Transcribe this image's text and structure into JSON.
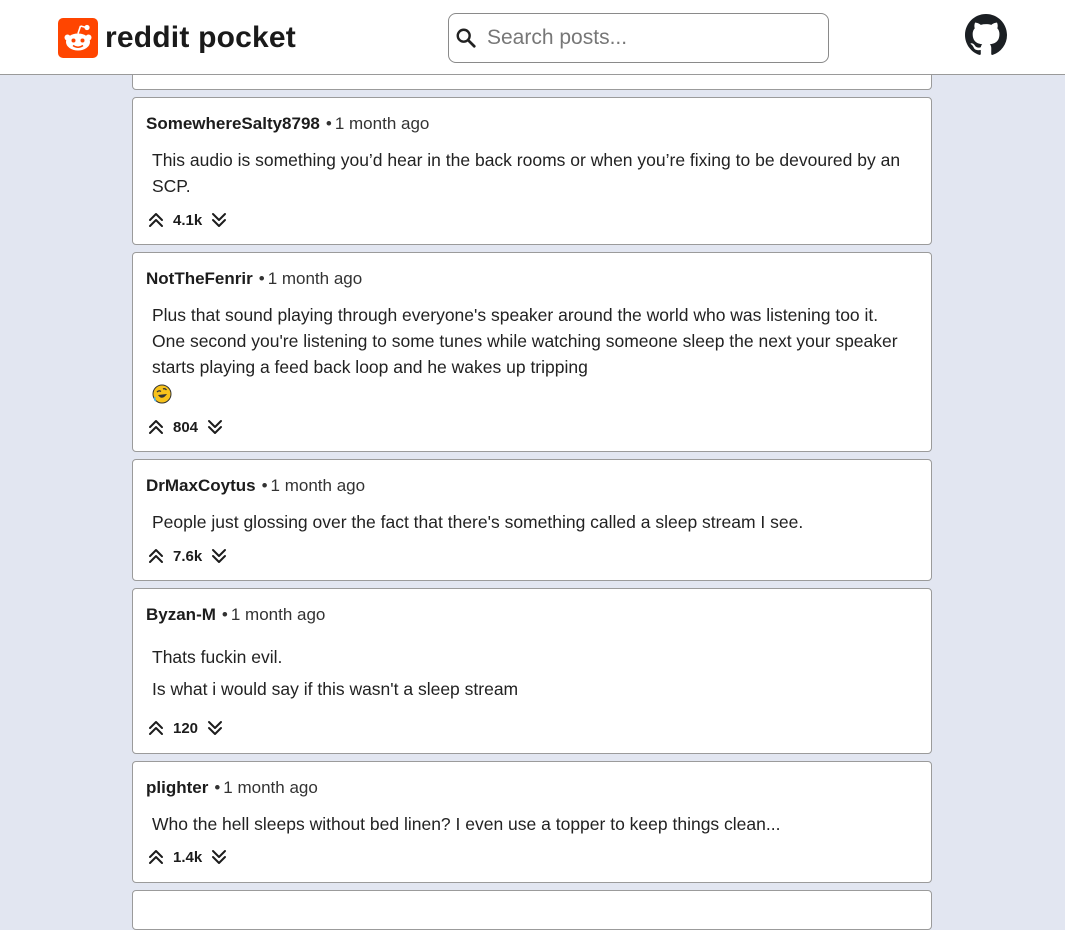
{
  "header": {
    "brand": "reddit pocket",
    "search_placeholder": "Search posts..."
  },
  "colors": {
    "brand": "#ff4500",
    "background": "#e2e6f1"
  },
  "comments": [
    {
      "author": "SomewhereSalty8798",
      "time": "1 month ago",
      "paragraphs": [
        "This audio is something you’d hear in the back rooms or when you’re fixing to be devoured by an SCP."
      ],
      "score": "4.1k"
    },
    {
      "author": "NotTheFenrir",
      "time": "1 month ago",
      "paragraphs": [
        "Plus that sound playing through everyone's speaker around the world who was listening too it. One second you're listening to some tunes while watching someone sleep the next your speaker starts playing a feed back loop and he wakes up tripping"
      ],
      "emoji": "rolling-on-floor-laughing-emoji",
      "score": "804"
    },
    {
      "author": "DrMaxCoytus",
      "time": "1 month ago",
      "paragraphs": [
        "People just glossing over the fact that there's something called a sleep stream I see."
      ],
      "score": "7.6k"
    },
    {
      "author": "Byzan-M",
      "time": "1 month ago",
      "paragraphs": [
        "Thats fuckin evil.",
        "Is what i would say if this wasn't a sleep stream"
      ],
      "score": "120"
    },
    {
      "author": "plighter",
      "time": "1 month ago",
      "paragraphs": [
        "Who the hell sleeps without bed linen? I even use a topper to keep things clean..."
      ],
      "score": "1.4k"
    }
  ]
}
